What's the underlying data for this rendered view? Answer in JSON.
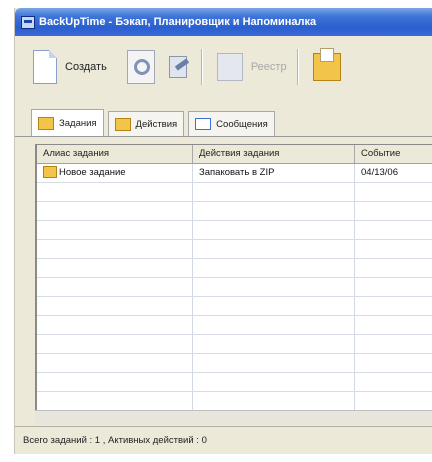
{
  "window": {
    "title": "BackUpTime - Бэкап, Планировщик и Напоминалка"
  },
  "toolbar": {
    "create_label": "Создать",
    "registry_label": "Реестр"
  },
  "tabs": [
    {
      "label": "Задания"
    },
    {
      "label": "Действия"
    },
    {
      "label": "Сообщения"
    }
  ],
  "table": {
    "columns": [
      "Алиас задания",
      "Действия задания",
      "Событие"
    ],
    "rows": [
      {
        "alias": "Новое задание",
        "action": "Запаковать в ZIP",
        "event": "04/13/06"
      }
    ]
  },
  "status": {
    "text": "Всего заданий : 1 , Активных действий : 0"
  }
}
